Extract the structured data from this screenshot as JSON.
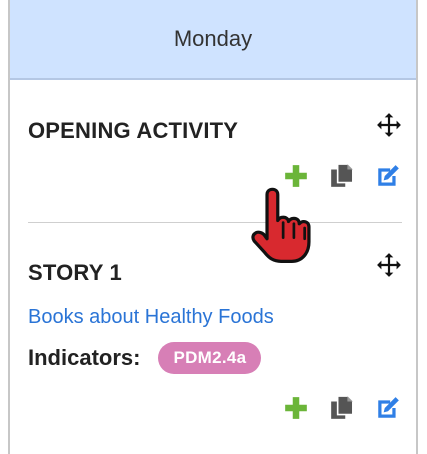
{
  "day": {
    "title": "Monday"
  },
  "blocks": [
    {
      "title": "OPENING ACTIVITY",
      "icons": {
        "move": "move-arrows-icon",
        "add": "plus-icon",
        "copy": "copy-icon",
        "edit": "edit-icon"
      }
    },
    {
      "title": "STORY 1",
      "link": "Books about Healthy Foods",
      "indicators_label": "Indicators:",
      "indicator_badge": "PDM2.4a",
      "icons": {
        "move": "move-arrows-icon",
        "add": "plus-icon",
        "copy": "copy-icon",
        "edit": "edit-icon"
      }
    }
  ],
  "colors": {
    "header_bg": "#cfe3ff",
    "plus": "#6bb539",
    "copy": "#555555",
    "edit": "#2f7fe6",
    "link": "#2a74d6",
    "badge": "#d77fb6",
    "cursor": "#d8292f"
  }
}
